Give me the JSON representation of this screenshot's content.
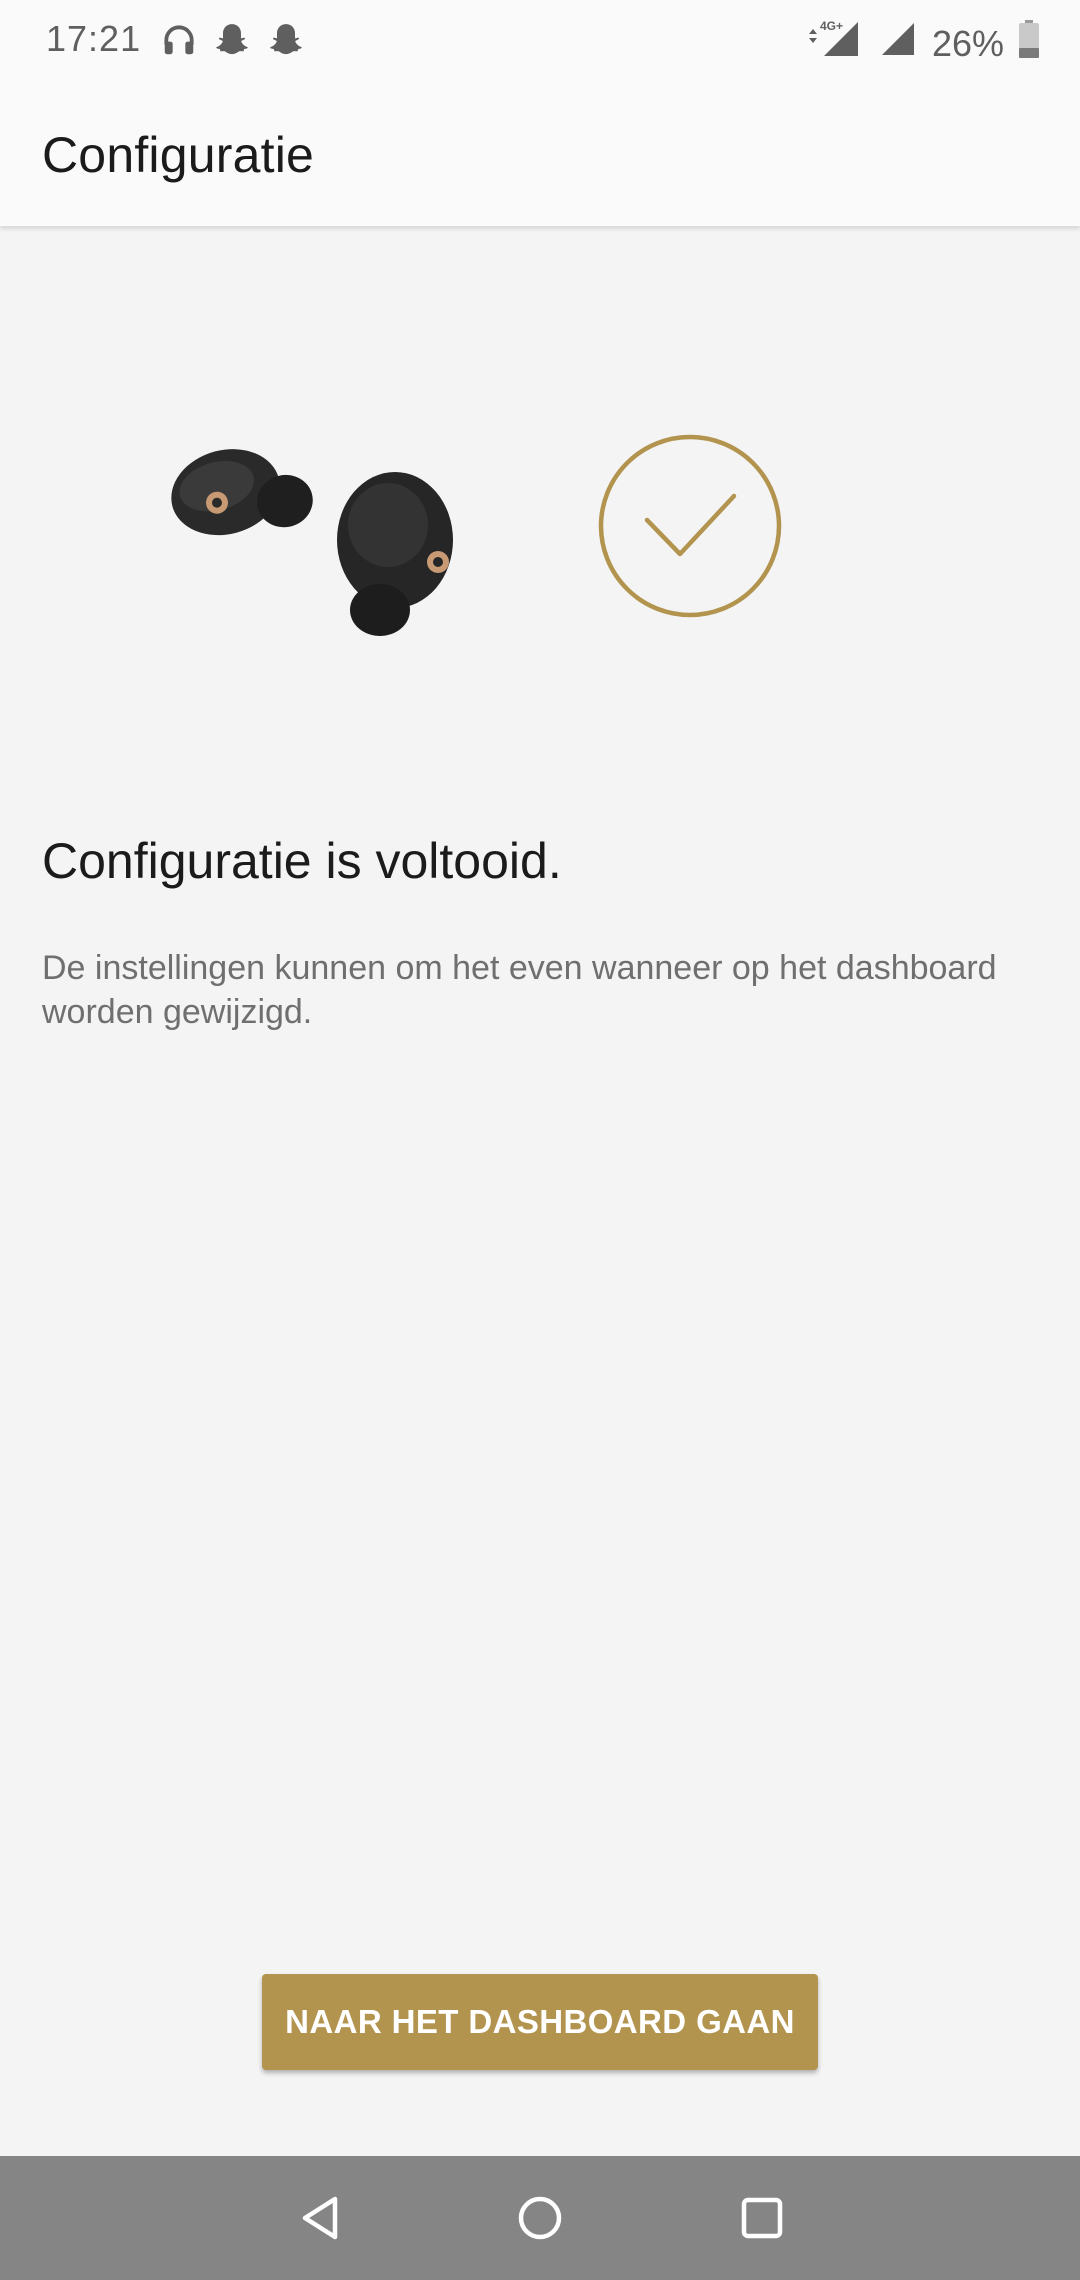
{
  "status_bar": {
    "time": "17:21",
    "battery": "26%",
    "network": "4G+"
  },
  "app_bar": {
    "title": "Configuratie"
  },
  "main": {
    "headline": "Configuratie is voltooid.",
    "description": "De instellingen kunnen om het even wanneer op het dashboard worden gewijzigd.",
    "button_label": "NAAR HET DASHBOARD GAAN"
  },
  "colors": {
    "accent": "#b2944f",
    "background": "#f4f4f4",
    "nav_bar": "#858585"
  },
  "icons": {
    "status_left": [
      "headphones-icon",
      "snapchat-icon",
      "snapchat-icon"
    ],
    "status_right": [
      "data-arrows-icon",
      "signal-icon",
      "signal-icon",
      "battery-icon"
    ],
    "nav": [
      "back-icon",
      "home-icon",
      "recents-icon"
    ]
  }
}
